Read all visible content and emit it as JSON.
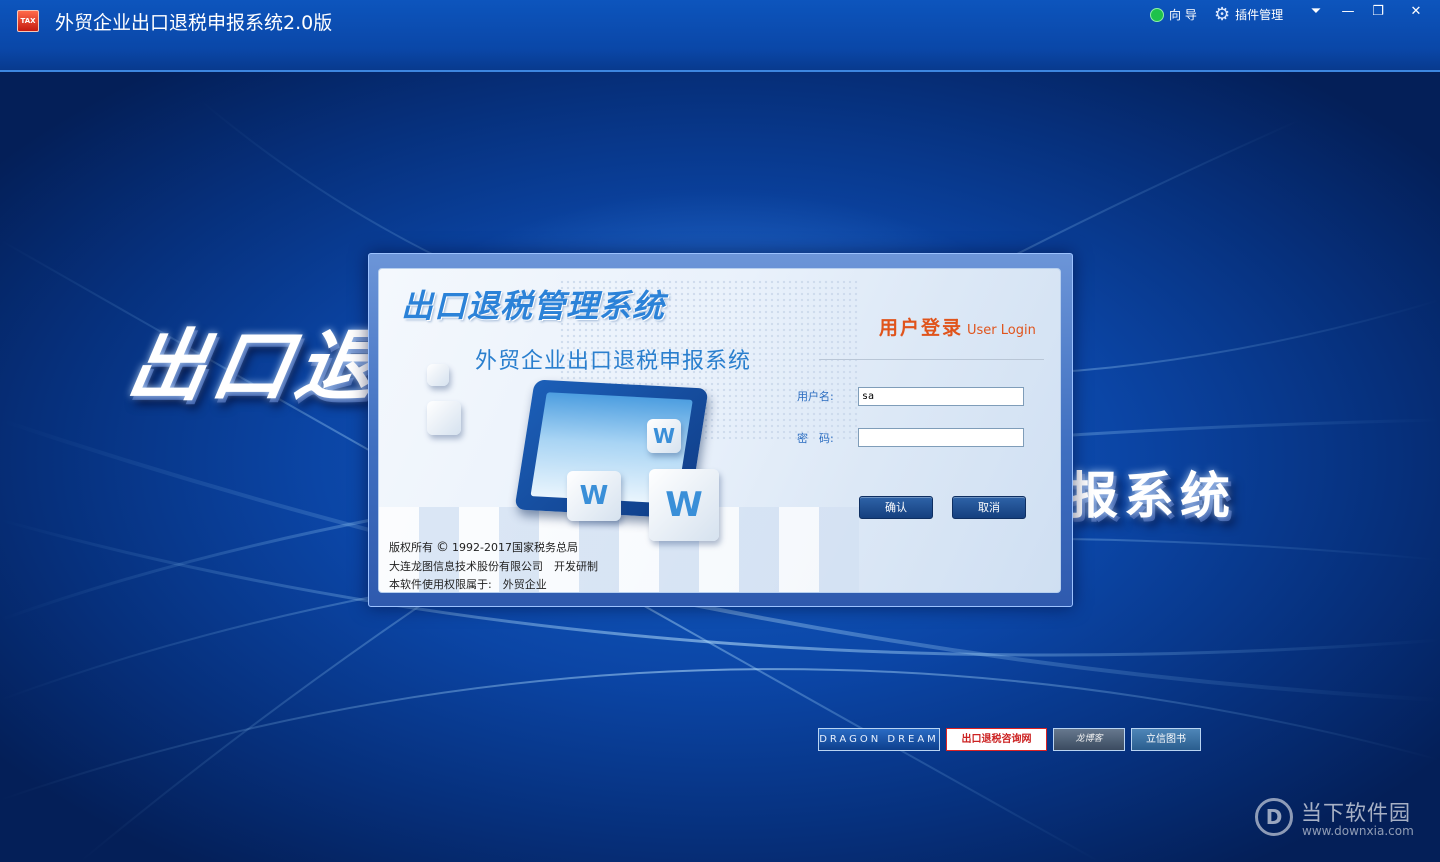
{
  "window": {
    "title": "外贸企业出口退税申报系统2.0版",
    "icon_label": "TAX",
    "toolbar": {
      "wizard_label": "向 导",
      "plugin_label": "插件管理"
    },
    "controls": {
      "menu": "⏷",
      "minimize": "—",
      "restore": "❐",
      "close": "✕"
    }
  },
  "background": {
    "left_text": "出口退",
    "right_text": "报系统"
  },
  "dialog": {
    "system_title": "出口退税管理系统",
    "subtitle": "外贸企业出口退税申报系统",
    "login_title_cn": "用户登录",
    "login_title_en": "User Login",
    "username_label": "用户名:",
    "username_value": "sa",
    "password_label": "密　码:",
    "password_value": "",
    "confirm_label": "确认",
    "cancel_label": "取消",
    "copyright": {
      "line1_prefix": "版权所有",
      "line1_symbol": "©",
      "line1_suffix": "1992-2017国家税务总局",
      "line2": "大连龙图信息技术股份有限公司　开发研制",
      "line3": "本软件使用权限属于:　外贸企业"
    }
  },
  "logos": [
    "DRAGON DREAM",
    "出口退税咨询网",
    "龙博客",
    "立信图书"
  ],
  "watermark": {
    "text": "当下软件园",
    "url": "www.downxia.com"
  },
  "colors": {
    "titlebar": "#0a47a8",
    "accent_blue": "#2b82d8",
    "login_orange": "#e0541c",
    "button_navy": "#153f7e"
  }
}
